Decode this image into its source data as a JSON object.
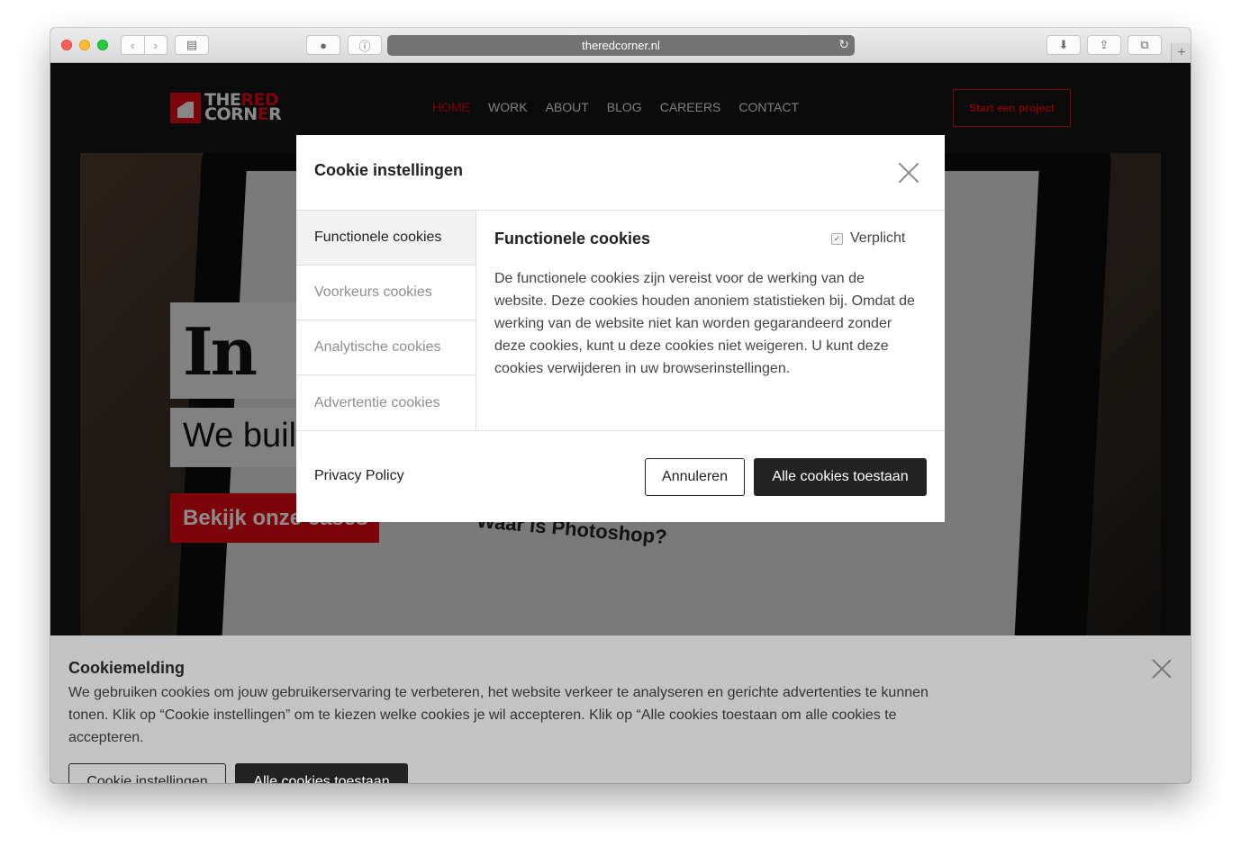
{
  "browser": {
    "url": "theredcorner.nl",
    "new_tab": "+"
  },
  "site": {
    "logo": {
      "line1": "THE",
      "line1_red": "RED",
      "line2": "CORN",
      "line2_red": "E",
      "line2_end": "R"
    },
    "nav": [
      "HOME",
      "WORK",
      "ABOUT",
      "BLOG",
      "CAREERS",
      "CONTACT"
    ],
    "active_nav": "HOME",
    "cta": "Start een project",
    "hero": {
      "heading": "In it",
      "subheading": "We buil",
      "button": "Bekijk onze cases",
      "photo_text": "Waar is Photoshop?"
    },
    "brand_color": "#e30613"
  },
  "modal": {
    "title": "Cookie instellingen",
    "tabs": [
      "Functionele cookies",
      "Voorkeurs cookies",
      "Analytische cookies",
      "Advertentie cookies"
    ],
    "active_tab": 0,
    "content": {
      "title": "Functionele cookies",
      "required_label": "Verplicht",
      "required_checked": true,
      "description": "De functionele cookies zijn vereist voor de werking van de website. Deze cookies houden anoniem statistieken bij. Omdat de werking van de website niet kan worden gegarandeerd zonder deze cookies, kunt u deze cookies niet weigeren. U kunt deze cookies verwijderen in uw browserinstellingen."
    },
    "privacy_link": "Privacy Policy",
    "cancel_label": "Annuleren",
    "accept_all_label": "Alle cookies toestaan"
  },
  "banner": {
    "title": "Cookiemelding",
    "text": "We gebruiken cookies om jouw gebruikerservaring te verbeteren, het website verkeer te analyseren en gerichte advertenties te kunnen tonen. Klik op “Cookie instellingen” om te kiezen welke cookies je wil accepteren. Klik op “Alle cookies toestaan om alle cookies te accepteren.",
    "settings_label": "Cookie instellingen",
    "accept_all_label": "Alle cookies toestaan"
  }
}
